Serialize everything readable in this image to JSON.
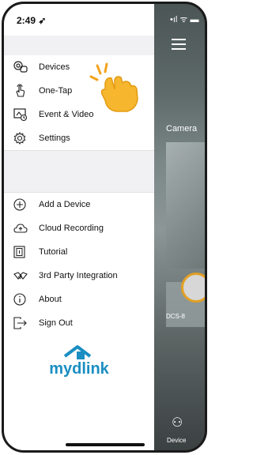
{
  "status": {
    "time": "2:49"
  },
  "menu": {
    "items_top": [
      {
        "label": "Devices",
        "icon": "camera-devices-icon"
      },
      {
        "label": "One-Tap",
        "icon": "hand-tap-icon"
      },
      {
        "label": "Event & Video",
        "icon": "event-video-icon"
      },
      {
        "label": "Settings",
        "icon": "gear-icon"
      }
    ],
    "items_bottom": [
      {
        "label": "Add a Device",
        "icon": "plus-circle-icon"
      },
      {
        "label": "Cloud Recording",
        "icon": "cloud-icon"
      },
      {
        "label": "Tutorial",
        "icon": "tutorial-book-icon"
      },
      {
        "label": "3rd Party Integration",
        "icon": "integration-icon"
      },
      {
        "label": "About",
        "icon": "info-icon"
      },
      {
        "label": "Sign Out",
        "icon": "sign-out-icon"
      }
    ]
  },
  "logo": {
    "text_prefix": "my",
    "text_suffix": "dlink"
  },
  "background": {
    "camera_label": "Camera",
    "tile_label": "DCS-8",
    "bottom_label": "Device"
  },
  "colors": {
    "brand": "#1a8ec2",
    "accent": "#e2a024"
  }
}
